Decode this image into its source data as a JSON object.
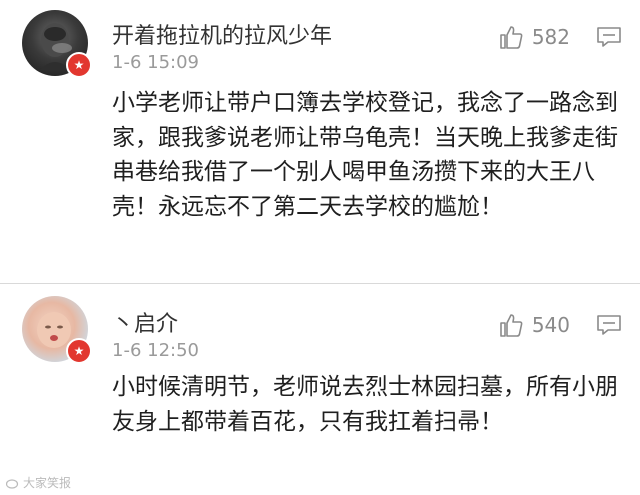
{
  "comments": [
    {
      "username": "开着拖拉机的拉风少年",
      "time": "1-6 15:09",
      "likes": "582",
      "badge_icon": "star-icon",
      "text": "小学老师让带户口簿去学校登记，我念了一路念到家，跟我爹说老师让带乌龟壳！当天晚上我爹走街串巷给我借了一个别人喝甲鱼汤攒下来的大王八壳！永远忘不了第二天去学校的尴尬！"
    },
    {
      "username": "丶启介",
      "time": "1-6 12:50",
      "likes": "540",
      "badge_icon": "star-icon",
      "text": "小时候清明节，老师说去烈士林园扫墓，所有小朋友身上都带着百花，只有我扛着扫帚！"
    }
  ],
  "watermark": "大家笑报",
  "colors": {
    "badge": "#e2372f",
    "meta": "#9a9a9a"
  }
}
